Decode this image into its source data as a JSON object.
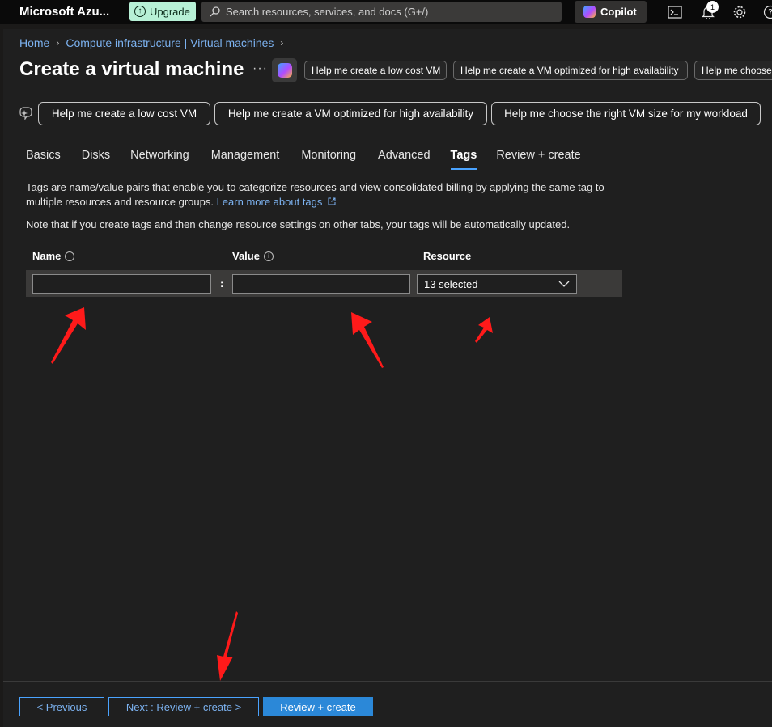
{
  "topbar": {
    "brand": "Microsoft Azu...",
    "upgrade_label": "Upgrade",
    "search_placeholder": "Search resources, services, and docs (G+/)",
    "copilot_label": "Copilot",
    "notification_count": "1",
    "icons": [
      "cloud-shell-icon",
      "bell-icon",
      "gear-icon",
      "help-icon"
    ]
  },
  "breadcrumb": {
    "items": [
      "Home",
      "Compute infrastructure | Virtual machines"
    ]
  },
  "page": {
    "title": "Create a virtual machine",
    "more": "···"
  },
  "header_chips": [
    "Help me create a low cost VM",
    "Help me create a VM optimized for high availability",
    "Help me choose"
  ],
  "suggestions": [
    "Help me create a low cost VM",
    "Help me create a VM optimized for high availability",
    "Help me choose the right VM size for my workload"
  ],
  "tabs": [
    {
      "label": "Basics",
      "active": false
    },
    {
      "label": "Disks",
      "active": false
    },
    {
      "label": "Networking",
      "active": false
    },
    {
      "label": "Management",
      "active": false
    },
    {
      "label": "Monitoring",
      "active": false
    },
    {
      "label": "Advanced",
      "active": false
    },
    {
      "label": "Tags",
      "active": true
    },
    {
      "label": "Review + create",
      "active": false
    }
  ],
  "tags": {
    "description": "Tags are name/value pairs that enable you to categorize resources and view consolidated billing by applying the same tag to multiple resources and resource groups.",
    "learn_more": "Learn more about tags",
    "note": "Note that if you create tags and then change resource settings on other tabs, your tags will be automatically updated.",
    "columns": {
      "name": "Name",
      "value": "Value",
      "resource": "Resource"
    },
    "row": {
      "name_value": "",
      "value_value": "",
      "separator": ":",
      "resource_selected": "13 selected"
    }
  },
  "footer": {
    "previous": "< Previous",
    "next": "Next : Review + create >",
    "review_create": "Review + create"
  },
  "colors": {
    "accent": "#2b88d8",
    "link": "#7cb2f0",
    "annotation": "#ff1a1a",
    "upgrade_bg": "#b7f0d6"
  }
}
